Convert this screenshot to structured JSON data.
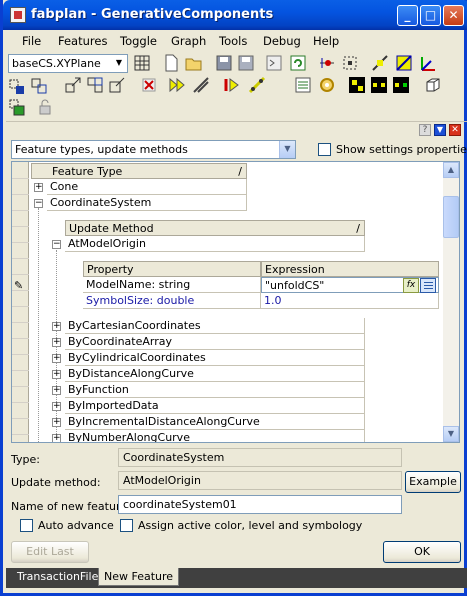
{
  "window": {
    "title": "fabplan - GenerativeComponents",
    "minimize_label": "_",
    "maximize_label": "□",
    "close_label": "✕"
  },
  "menu": {
    "items": [
      "File",
      "Features",
      "Toggle",
      "Graph",
      "Tools",
      "Debug",
      "Help"
    ]
  },
  "toolbar": {
    "plane_selector_value": "baseCS.XYPlane",
    "icons_row1": [
      "grid-icon",
      "new-icon",
      "open-icon",
      "save-icon",
      "save-as-icon",
      "script-icon",
      "refresh-icon",
      "connect-icon",
      "select-icon",
      "point-icon",
      "plane-icon",
      "axis-icon"
    ],
    "icons_row2": [
      "feature-select-icon",
      "feature-copy-icon",
      "move-icon",
      "group-icon",
      "transform-icon",
      "delete-icon",
      "play-icon",
      "line-icon",
      "update-icon",
      "path-icon",
      "table-icon",
      "rotate-icon",
      "node-icon",
      "node-group-icon",
      "node-link-icon",
      "cube-icon"
    ],
    "icons_row3": [
      "component-icon",
      "lock-icon"
    ]
  },
  "panel_controls": {
    "help": "?",
    "pin": "▼",
    "close": "✕"
  },
  "mode": {
    "selected": "Feature types, update methods",
    "show_settings_label": "Show settings properties",
    "show_settings_checked": false
  },
  "grid": {
    "feature_type_header": "Feature Type",
    "sort_glyph": "/",
    "feature_types": [
      {
        "name": "Cone",
        "expanded": false
      },
      {
        "name": "CoordinateSystem",
        "expanded": true
      }
    ],
    "update_method_header": "Update Method",
    "selected_method": "AtModelOrigin",
    "property_header": "Property",
    "expression_header": "Expression",
    "properties": [
      {
        "name": "ModelName: string",
        "expression": "\"unfoldCS\"",
        "color": "#000000"
      },
      {
        "name": "SymbolSize: double",
        "expression": "1.0",
        "color": "#1a1aa6"
      }
    ],
    "fx_label": "fx",
    "methods": [
      "ByCartesianCoordinates",
      "ByCoordinateArray",
      "ByCylindricalCoordinates",
      "ByDistanceAlongCurve",
      "ByFunction",
      "ByImportedData",
      "ByIncrementalDistanceAlongCurve",
      "ByNumberAlongCurve"
    ]
  },
  "form": {
    "type_label": "Type:",
    "type_value": "CoordinateSystem",
    "update_method_label": "Update method:",
    "update_method_value": "AtModelOrigin",
    "example_label": "Example",
    "new_feature_label": "Name of new feature:",
    "new_feature_value": "coordinateSystem01",
    "auto_advance_label": "Auto advance",
    "assign_label": "Assign active color, level and symbology",
    "edit_last_label": "Edit Last",
    "ok_label": "OK"
  },
  "tabs": [
    "TransactionFile",
    "New Feature"
  ],
  "active_tab": "New Feature"
}
